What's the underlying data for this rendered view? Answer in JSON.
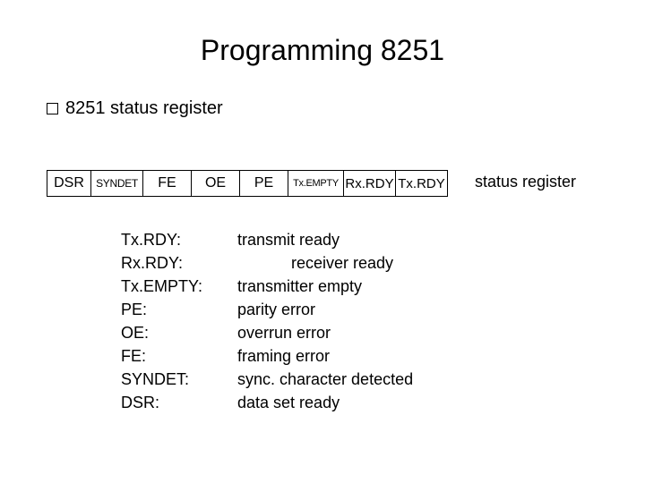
{
  "title": "Programming 8251",
  "bullet_text": "8251 status register",
  "register": {
    "cells": {
      "dsr": "DSR",
      "syndet": "SYNDET",
      "fe": "FE",
      "oe": "OE",
      "pe": "PE",
      "txempty": "Tx.EMPTY",
      "rxrdy": "Rx.RDY",
      "txrdy": "Tx.RDY"
    },
    "label": "status register"
  },
  "definitions": [
    {
      "term": "Tx.RDY:",
      "desc": "transmit ready"
    },
    {
      "term": "Rx.RDY:",
      "desc": "            receiver ready"
    },
    {
      "term": "Tx.EMPTY:",
      "desc": "transmitter empty"
    },
    {
      "term": "PE:",
      "desc": "parity error"
    },
    {
      "term": "OE:",
      "desc": "overrun error"
    },
    {
      "term": "FE:",
      "desc": "framing error"
    },
    {
      "term": "SYNDET:",
      "desc": "sync. character detected"
    },
    {
      "term": "DSR:",
      "desc": "data set ready"
    }
  ]
}
